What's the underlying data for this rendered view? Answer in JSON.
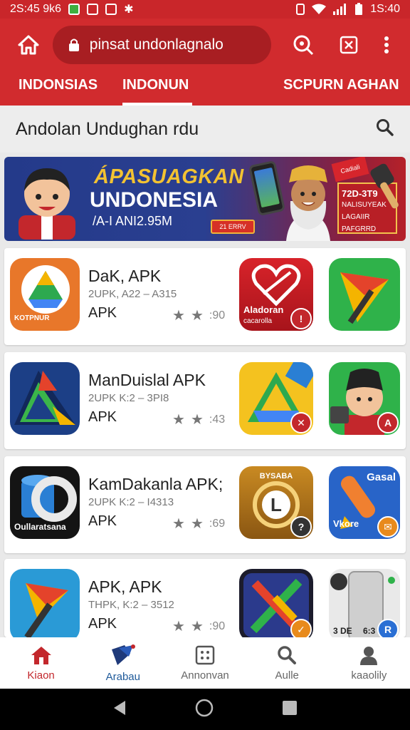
{
  "status_bar": {
    "left_text": "2S:45 9k6",
    "time": "1S:40"
  },
  "toolbar": {
    "url_text": "pinsat undonlagnalo"
  },
  "tabs": [
    {
      "label": "INDONSIAS"
    },
    {
      "label": "INDONUN"
    },
    {
      "label": "SCPURN AGHAN"
    }
  ],
  "search": {
    "title": "Andolan Undughan rdu"
  },
  "banner": {
    "headline_1": "ÁPASUAGKAN",
    "headline_2": "UNDONESIA",
    "subtext": "/A-I ANI2.95M",
    "badge": "21 ERRV",
    "tag_red": "Cadiali",
    "box_line1": "72D-3T9",
    "box_line2": "NALISUYEAK",
    "box_line3": "LAGAIIR",
    "box_line4": "PAFGRRD",
    "colors": {
      "accent": "#f2c232",
      "primary": "#d12b2e"
    }
  },
  "apps": [
    {
      "name": "DaK, APK",
      "meta": "2UPK, A22 – A315",
      "type": "APK",
      "rating_text": ":90",
      "icon_caption": "KOTPNUR",
      "thumb1_caption": "Aladoran",
      "thumb1_sub": "cacarolla"
    },
    {
      "name": "ManDuislal APK",
      "meta": "2UPK  K:2 – 3PI8",
      "type": "APK",
      "rating_text": ":43"
    },
    {
      "name": "KamDakanla APK;",
      "meta": "2UPK  K:2 – I4313",
      "type": "APK",
      "rating_text": ":69",
      "icon_caption": "Oullaratsana",
      "thumb2_caption_top": "Gasal",
      "thumb2_caption_bottom": "Vkore",
      "thumb1_caption": "BYSABA"
    },
    {
      "name": "APK, APK",
      "meta": "THPK,  K:2 – 3512",
      "type": "APK",
      "rating_text": ":90",
      "thumb2_caption_left": "3 DE",
      "thumb2_caption_right": "6:3"
    }
  ],
  "bottom_nav": [
    {
      "label": "Kiaon"
    },
    {
      "label": "Arabau"
    },
    {
      "label": "Annonvan"
    },
    {
      "label": "Aulle"
    },
    {
      "label": "kaaolily"
    }
  ]
}
